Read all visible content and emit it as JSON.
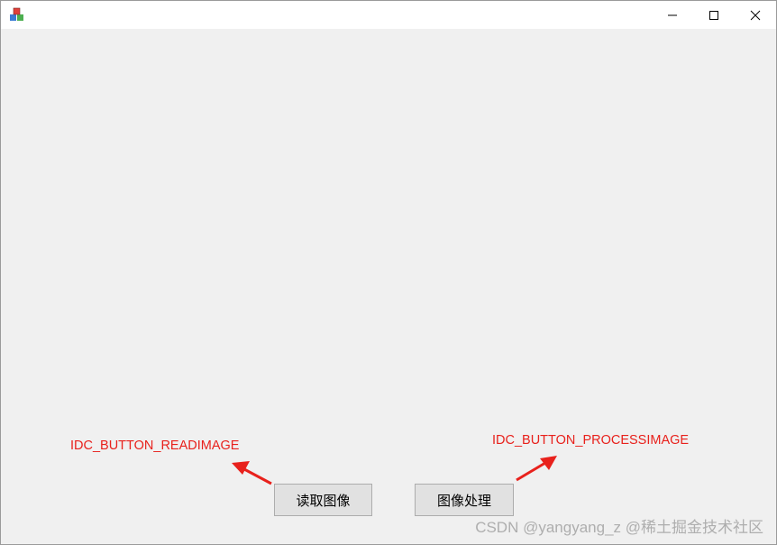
{
  "window": {
    "title": "",
    "controls": [
      "minimize-icon",
      "maximize-icon",
      "close-icon"
    ]
  },
  "buttons": {
    "read_image": "读取图像",
    "process_image": "图像处理"
  },
  "annotations": {
    "read_image_id": "IDC_BUTTON_READIMAGE",
    "process_image_id": "IDC_BUTTON_PROCESSIMAGE",
    "color": "#e8211c"
  },
  "watermark": "CSDN @yangyang_z  @稀土掘金技术社区"
}
